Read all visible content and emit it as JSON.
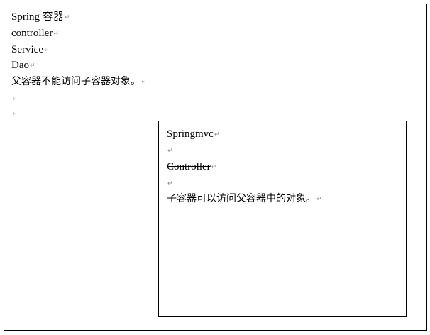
{
  "paragraph_mark": "↵",
  "outer": {
    "lines": [
      "Spring 容器",
      "controller",
      "Service",
      "Dao",
      "父容器不能访问子容器对象。",
      "",
      ""
    ]
  },
  "inner": {
    "lines": [
      "Springmvc",
      "",
      "Controller",
      "",
      "子容器可以访问父容器中的对象。"
    ]
  }
}
